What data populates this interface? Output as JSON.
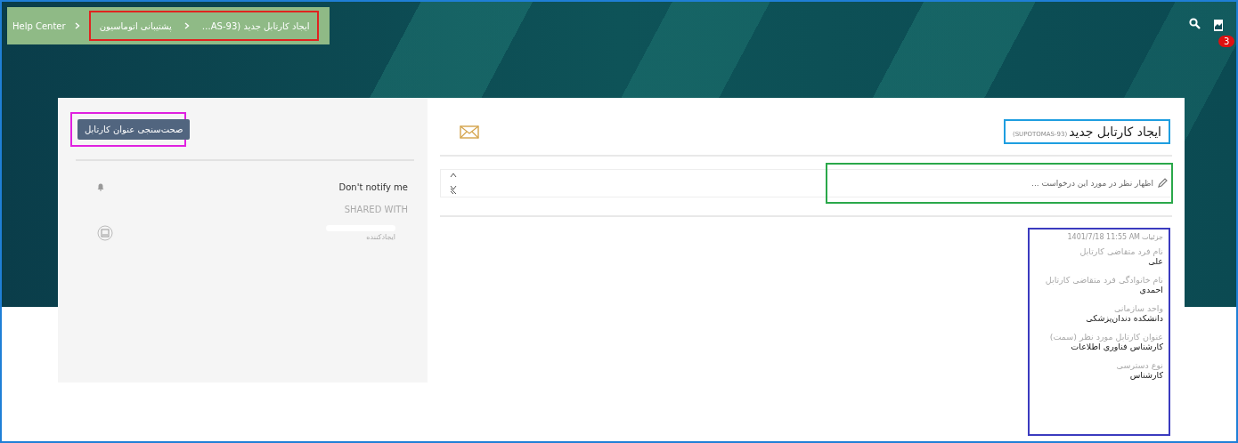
{
  "breadcrumb": [
    {
      "label": "ایجاد کارتابل جدید (AS-93…"
    },
    {
      "label": "پشتیبانی اتوماسیون"
    },
    {
      "label": "Help Center"
    }
  ],
  "header": {
    "notification_count": "3"
  },
  "side_panel": {
    "validate_button": "صحت‌سنجی عنوان کارتابل",
    "notify_label": "Don't notify me",
    "shared_heading": "SHARED WITH",
    "shared_people": [
      {
        "role": "ایجادکننده"
      }
    ]
  },
  "ticket": {
    "title": "ایجاد کارتابل جدید",
    "key": "(SUPOTOMAS-93)",
    "comment": {
      "placeholder": "اظهار نظر در مورد این درخواست ..."
    },
    "details_heading": "جزئیات",
    "details_time": "1401/7/18 11:55 AM",
    "fields": [
      {
        "label": "نام فرد متقاضی کارتابل",
        "value": "علی"
      },
      {
        "label": "نام خانوادگی فرد متقاضی کارتابل",
        "value": "احمدی"
      },
      {
        "label": "واحد سازمانی",
        "value": "دانشکده دندان‌پزشکی"
      },
      {
        "label": "عنوان کارتابل مورد نظر (سمت)",
        "value": "کارشناس فناوری اطلاعات"
      },
      {
        "label": "نوع دسترسی",
        "value": "کارشناس"
      }
    ]
  }
}
